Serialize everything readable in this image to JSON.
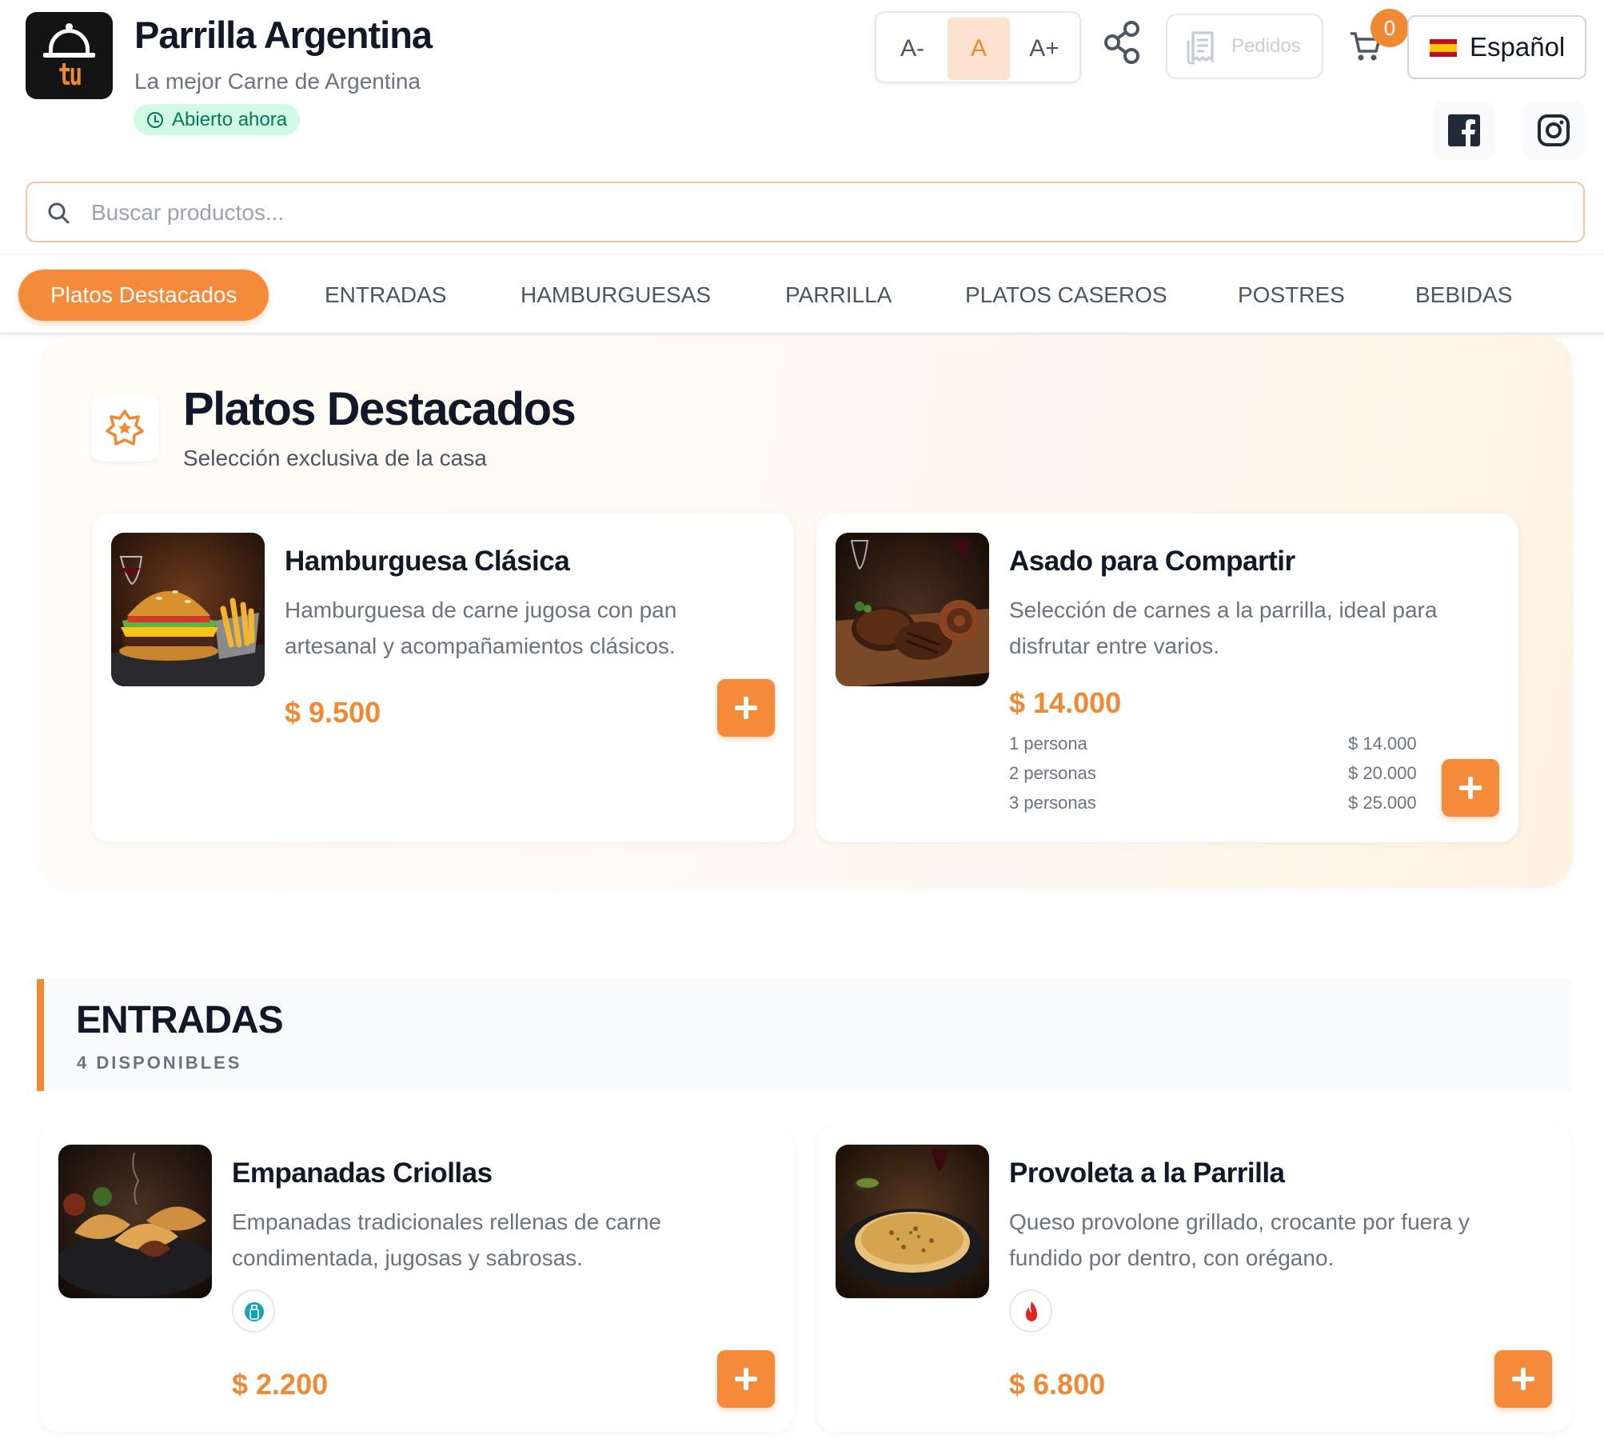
{
  "header": {
    "logo_text": "tu menu",
    "restaurant_name": "Parrilla Argentina",
    "tagline": "La mejor Carne de Argentina",
    "status": "Abierto ahora",
    "font_controls": {
      "decrease": "A-",
      "normal": "A",
      "increase": "A+"
    },
    "orders_label": "Pedidos",
    "cart_count": "0",
    "language": "Español"
  },
  "search": {
    "placeholder": "Buscar productos..."
  },
  "nav": {
    "tabs": [
      {
        "label": "Platos Destacados",
        "active": true
      },
      {
        "label": "ENTRADAS"
      },
      {
        "label": "HAMBURGUESAS"
      },
      {
        "label": "PARRILLA"
      },
      {
        "label": "PLATOS CASEROS"
      },
      {
        "label": "POSTRES"
      },
      {
        "label": "BEBIDAS"
      }
    ]
  },
  "featured": {
    "title": "Platos Destacados",
    "subtitle": "Selección exclusiva de la casa",
    "items": [
      {
        "name": "Hamburguesa Clásica",
        "description_line1": "Hamburguesa de carne jugosa con pan",
        "description_line2": "artesanal y acompañamientos clásicos.",
        "price": "$ 9.500"
      },
      {
        "name": "Asado para Compartir",
        "description_line1": "Selección de carnes a la parrilla, ideal para",
        "description_line2": "disfrutar entre varios.",
        "price": "$ 14.000",
        "variants": [
          {
            "label": "1 persona",
            "price": "$ 14.000"
          },
          {
            "label": "2 personas",
            "price": "$ 20.000"
          },
          {
            "label": "3 personas",
            "price": "$ 25.000"
          }
        ]
      }
    ]
  },
  "entradas": {
    "title": "ENTRADAS",
    "count": "4 DISPONIBLES",
    "items": [
      {
        "name": "Empanadas Criollas",
        "description_line1": "Empanadas tradicionales rellenas de carne",
        "description_line2": "condimentada, jugosas y sabrosas.",
        "tag_icon": "bottle-icon",
        "price": "$ 2.200"
      },
      {
        "name": "Provoleta a la Parrilla",
        "description_line1": "Queso provolone grillado, crocante por fuera y",
        "description_line2": "fundido por dentro, con orégano.",
        "tag_icon": "flame-icon",
        "price": "$ 6.800"
      }
    ]
  },
  "colors": {
    "accent": "#f08a32",
    "open_badge_bg": "#d1fae5",
    "open_badge_text": "#047857"
  }
}
